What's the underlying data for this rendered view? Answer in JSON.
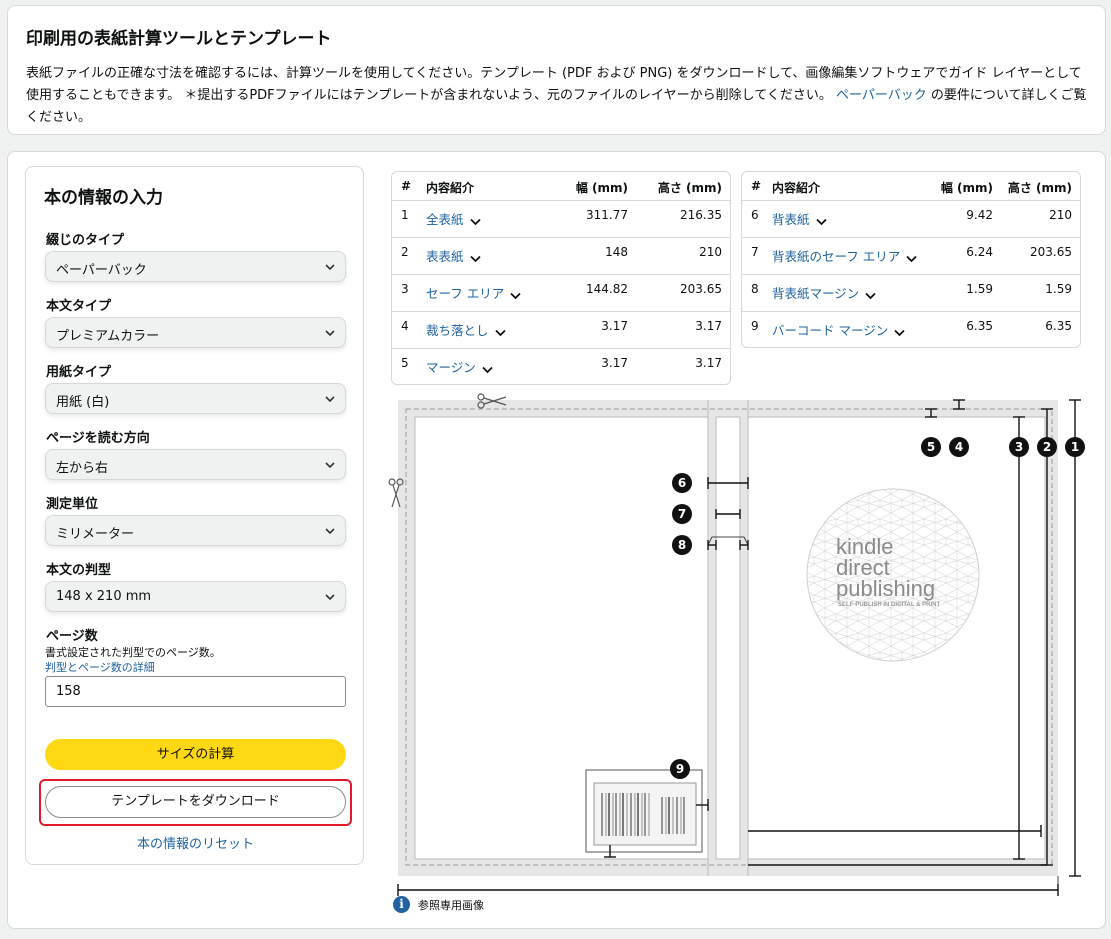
{
  "header": {
    "title": "印刷用の表紙計算ツールとテンプレート",
    "description": "表紙ファイルの正確な寸法を確認するには、計算ツールを使用してください。テンプレート (PDF および PNG) をダウンロードして、画像編集ソフトウェアでガイド レイヤーとして使用することもできます。 ＊提出するPDFファイルにはテンプレートが含まれないよう、元のファイルのレイヤーから削除してください。",
    "link_text": "ペーパーバック",
    "link_suffix": "の要件について詳しくご覧ください。"
  },
  "form": {
    "title": "本の情報の入力",
    "binding_label": "綴じのタイプ",
    "binding_value": "ペーパーバック",
    "interior_label": "本文タイプ",
    "interior_value": "プレミアムカラー",
    "paper_label": "用紙タイプ",
    "paper_value": "用紙 (白)",
    "direction_label": "ページを読む方向",
    "direction_value": "左から右",
    "unit_label": "測定単位",
    "unit_value": "ミリメーター",
    "trim_label": "本文の判型",
    "trim_value": "148 x 210 mm",
    "pages_label": "ページ数",
    "pages_help": "書式設定された判型でのページ数。",
    "pages_link": "判型とページ数の詳細",
    "pages_value": "158",
    "calc_button": "サイズの計算",
    "download_button": "テンプレートをダウンロード",
    "reset_link": "本の情報のリセット"
  },
  "table_headers": {
    "num": "#",
    "name": "内容紹介",
    "width": "幅 (mm)",
    "height": "高さ (mm)"
  },
  "table_left": [
    {
      "num": "1",
      "name": "全表紙",
      "width": "311.77",
      "height": "216.35"
    },
    {
      "num": "2",
      "name": "表表紙",
      "width": "148",
      "height": "210"
    },
    {
      "num": "3",
      "name": "セーフ エリア",
      "width": "144.82",
      "height": "203.65"
    },
    {
      "num": "4",
      "name": "裁ち落とし",
      "width": "3.17",
      "height": "3.17"
    },
    {
      "num": "5",
      "name": "マージン",
      "width": "3.17",
      "height": "3.17"
    }
  ],
  "table_right": [
    {
      "num": "6",
      "name": "背表紙",
      "width": "9.42",
      "height": "210"
    },
    {
      "num": "7",
      "name": "背表紙のセーフ エリア",
      "width": "6.24",
      "height": "203.65"
    },
    {
      "num": "8",
      "name": "背表紙マージン",
      "width": "1.59",
      "height": "1.59"
    },
    {
      "num": "9",
      "name": "バーコード マージン",
      "width": "6.35",
      "height": "6.35"
    }
  ],
  "diagram": {
    "markers": [
      "1",
      "2",
      "3",
      "4",
      "5",
      "6",
      "7",
      "8",
      "9"
    ],
    "logo_line1": "kindle",
    "logo_line2": "direct",
    "logo_line3": "publishing",
    "logo_tagline": "SELF-PUBLISH IN DIGITAL & PRINT",
    "note": "参照専用画像"
  },
  "colors": {
    "accent": "#ffd814",
    "link": "#2162a1",
    "focus": "#e3182b"
  }
}
